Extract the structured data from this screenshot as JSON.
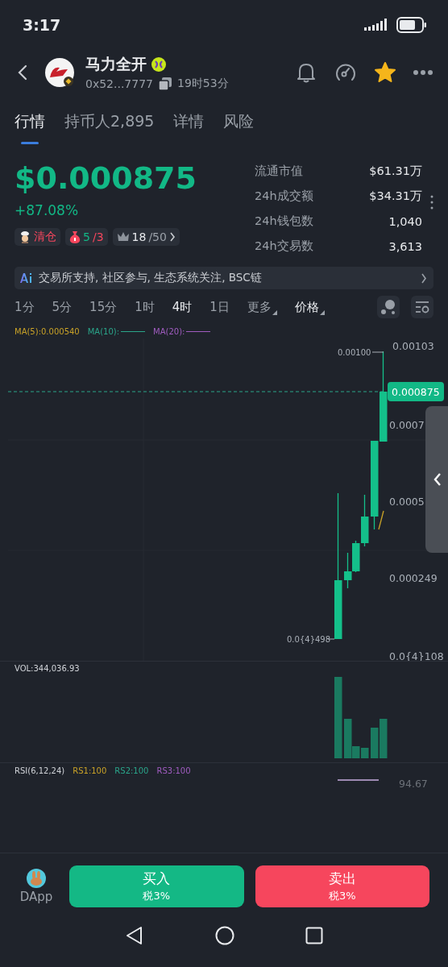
{
  "status_bar": {
    "time": "3:17"
  },
  "token": {
    "name": "马力全开",
    "address": "0x52...7777",
    "age": "19时53分",
    "favorited": true
  },
  "tabs": [
    {
      "label": "行情",
      "selected": true
    },
    {
      "label": "持币人2,895",
      "selected": false
    },
    {
      "label": "详情",
      "selected": false
    },
    {
      "label": "风险",
      "selected": false
    }
  ],
  "price": {
    "value": "$0.000875",
    "change": "+87.08%"
  },
  "tags": [
    {
      "kind": "dev",
      "text": "清仓"
    },
    {
      "kind": "snipers",
      "first": "5",
      "second": "/3"
    },
    {
      "kind": "top",
      "first": "18",
      "second": "/50"
    }
  ],
  "stats": [
    {
      "label": "流通市值",
      "value": "$61.31万"
    },
    {
      "label": "24h成交额",
      "value": "$34.31万"
    },
    {
      "label": "24h钱包数",
      "value": "1,040"
    },
    {
      "label": "24h交易数",
      "value": "3,613"
    }
  ],
  "ai_summary": "交易所支持, 社区参与, 生态系统关注, BSC链",
  "intervals": [
    {
      "label": "1分",
      "selected": false
    },
    {
      "label": "5分",
      "selected": false
    },
    {
      "label": "15分",
      "selected": false
    },
    {
      "label": "1时",
      "selected": false
    },
    {
      "label": "4时",
      "selected": true
    },
    {
      "label": "1日",
      "selected": false
    }
  ],
  "dropdowns": [
    {
      "label": "更多",
      "active": false
    },
    {
      "label": "价格",
      "active": true
    }
  ],
  "chart": {
    "ma_legend": [
      {
        "label": "MA(5):0.000540",
        "line": false,
        "color": "#c9a227"
      },
      {
        "label": "MA(10):",
        "line": true,
        "color": "#2aa58a"
      },
      {
        "label": "MA(20):",
        "line": true,
        "color": "#a05cc0"
      }
    ],
    "price_axis": [
      "0.00103",
      "0.0007",
      "0.0005",
      "0.000249",
      "0.0{4}108"
    ],
    "current_price": "0.000875",
    "high_label": "0.00100",
    "low_label": "0.0{4}498",
    "volume_label": "VOL:344,036.93",
    "rsi_label": "RSI(6,12,24)",
    "rsi_legend": [
      {
        "label": "RS1:100",
        "color": "#c9a227"
      },
      {
        "label": "RS2:100",
        "color": "#2aa58a"
      },
      {
        "label": "RS3:100",
        "color": "#a05cc0"
      }
    ],
    "rsi_axis": "94.67"
  },
  "bottom": {
    "dapp_label": "DApp",
    "buy": {
      "label": "买入",
      "tax": "税3%"
    },
    "sell": {
      "label": "卖出",
      "tax": "税3%"
    }
  }
}
